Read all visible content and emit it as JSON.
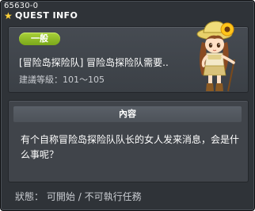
{
  "window": {
    "id_label": "65630-0",
    "title": "QUEST INFO",
    "title_icon": "star-icon"
  },
  "quest": {
    "type_badge": "一般",
    "title": "[冒险岛探险队] 冒险岛探险队需要..",
    "level_label": "建議等級：",
    "level_range": "101～105"
  },
  "npc": {
    "icon": "npc-explorer-girl-sunflower-hat"
  },
  "content": {
    "header": "內容",
    "text": "有个自称冒险岛探险队队长的女人发来消息，会是什么事呢？"
  },
  "status": {
    "label": "狀態：",
    "value": "可開始",
    "separator": "/",
    "condition": "不可執行任務"
  },
  "colors": {
    "window_bg": "#2f3338",
    "badge_green": "#8fbd26",
    "title_star": "#ffd23a"
  }
}
